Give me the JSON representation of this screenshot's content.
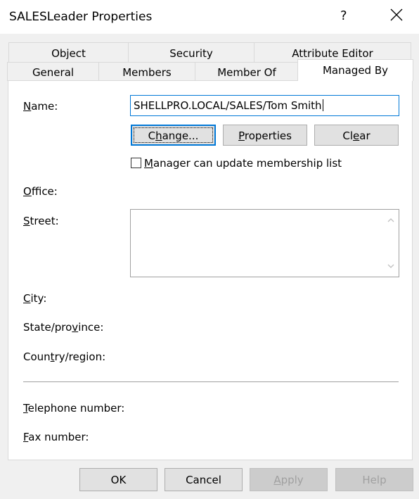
{
  "window": {
    "title": "SALESLeader Properties",
    "help_glyph": "?"
  },
  "tabs": {
    "row1": [
      "Object",
      "Security",
      "Attribute Editor"
    ],
    "row2": [
      "General",
      "Members",
      "Member Of",
      "Managed By"
    ],
    "active": "Managed By"
  },
  "managed_by": {
    "name_label_key": "N",
    "name_label_rest": "ame:",
    "name_value": "SHELLPRO.LOCAL/SALES/Tom Smith",
    "change_button": {
      "pre": "C",
      "key": "h",
      "post": "ange..."
    },
    "properties_button": {
      "pre": "",
      "key": "P",
      "post": "roperties"
    },
    "clear_button": {
      "pre": "Cl",
      "key": "e",
      "post": "ar"
    },
    "manager_checkbox": {
      "key": "M",
      "rest": "anager can update membership list",
      "checked": false
    },
    "office_label": {
      "key": "O",
      "rest": "ffice:"
    },
    "street_label": {
      "key": "S",
      "rest": "treet:"
    },
    "street_value": "",
    "city_label": {
      "key": "C",
      "rest": "ity:"
    },
    "state_label": {
      "pre": "State/pro",
      "key": "v",
      "post": "ince:"
    },
    "country_label": {
      "pre": "Coun",
      "key": "t",
      "post": "ry/region:"
    },
    "telephone_label": {
      "key": "T",
      "rest": "elephone number:"
    },
    "fax_label": {
      "key": "F",
      "rest": "ax number:"
    }
  },
  "footer": {
    "ok": "OK",
    "cancel": "Cancel",
    "apply": {
      "key": "A",
      "rest": "pply"
    },
    "help": "Help"
  }
}
